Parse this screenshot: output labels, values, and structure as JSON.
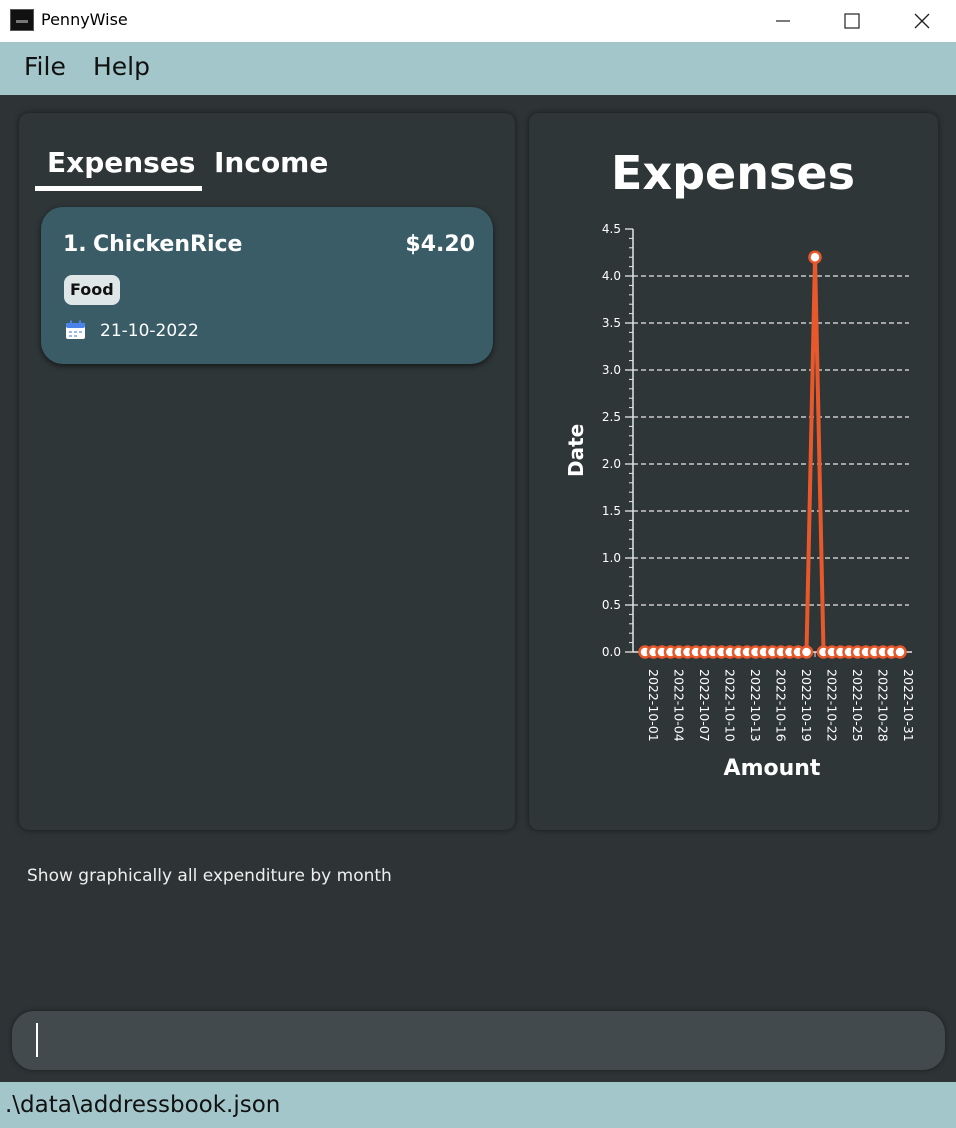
{
  "window": {
    "title": "PennyWise"
  },
  "menu": {
    "file": "File",
    "help": "Help"
  },
  "tabs": {
    "expenses": "Expenses",
    "income": "Income"
  },
  "entries": [
    {
      "index": "1.",
      "name": "ChickenRice",
      "amount": "$4.20",
      "tag": "Food",
      "date": "21-10-2022"
    }
  ],
  "result": {
    "message": "Show graphically all expenditure by month"
  },
  "command": {
    "value": ""
  },
  "status": {
    "path": ".\\data\\addressbook.json"
  },
  "chart_data": {
    "type": "line",
    "title": "Expenses",
    "xlabel": "Amount",
    "ylabel": "Date",
    "ylim": [
      0,
      4.5
    ],
    "y_ticks": [
      "0.0",
      "0.5",
      "1.0",
      "1.5",
      "2.0",
      "2.5",
      "3.0",
      "3.5",
      "4.0",
      "4.5"
    ],
    "x": [
      "2022-10-01",
      "2022-10-02",
      "2022-10-03",
      "2022-10-04",
      "2022-10-05",
      "2022-10-06",
      "2022-10-07",
      "2022-10-08",
      "2022-10-09",
      "2022-10-10",
      "2022-10-11",
      "2022-10-12",
      "2022-10-13",
      "2022-10-14",
      "2022-10-15",
      "2022-10-16",
      "2022-10-17",
      "2022-10-18",
      "2022-10-19",
      "2022-10-20",
      "2022-10-21",
      "2022-10-22",
      "2022-10-23",
      "2022-10-24",
      "2022-10-25",
      "2022-10-26",
      "2022-10-27",
      "2022-10-28",
      "2022-10-29",
      "2022-10-30",
      "2022-10-31"
    ],
    "x_tick_labels": [
      "2022-10-01",
      "2022-10-04",
      "2022-10-07",
      "2022-10-10",
      "2022-10-13",
      "2022-10-16",
      "2022-10-19",
      "2022-10-22",
      "2022-10-25",
      "2022-10-28",
      "2022-10-31"
    ],
    "values": [
      0,
      0,
      0,
      0,
      0,
      0,
      0,
      0,
      0,
      0,
      0,
      0,
      0,
      0,
      0,
      0,
      0,
      0,
      0,
      0,
      4.2,
      0,
      0,
      0,
      0,
      0,
      0,
      0,
      0,
      0,
      0
    ],
    "grid": "horizontal dashed",
    "line_color": "#e8582b"
  }
}
